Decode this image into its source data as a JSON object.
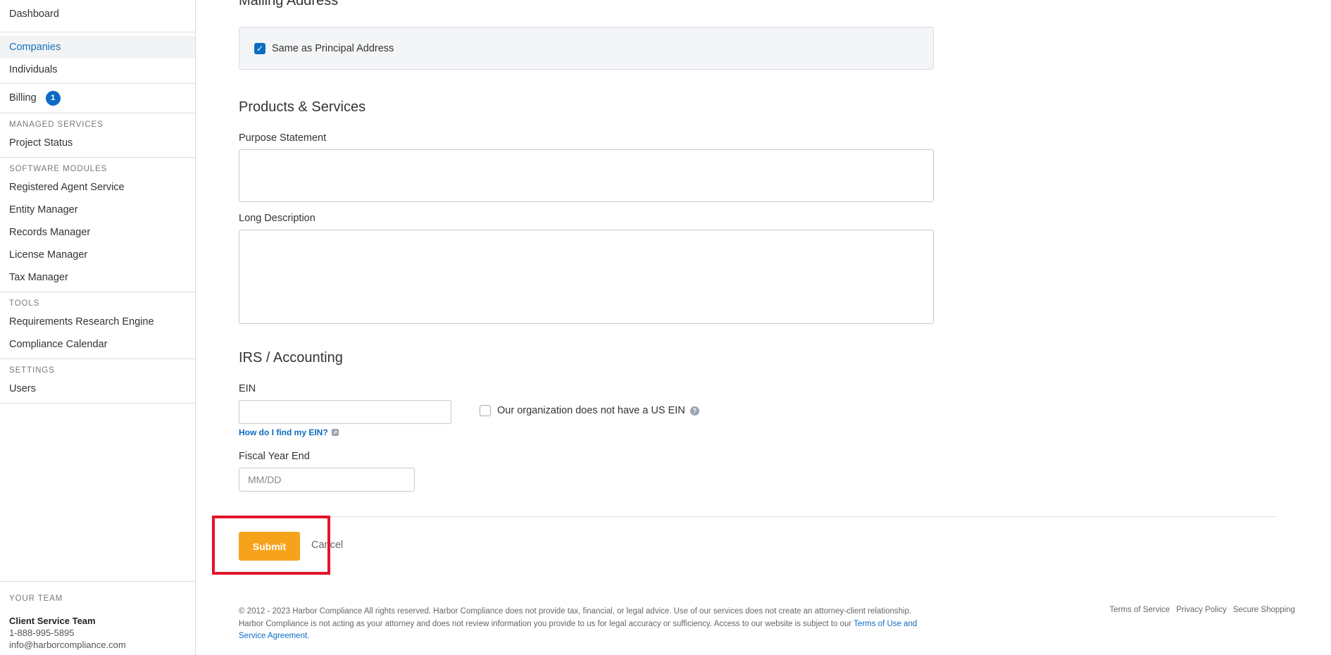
{
  "sidebar": {
    "dashboard": "Dashboard",
    "companies": "Companies",
    "individuals": "Individuals",
    "billing": "Billing",
    "billing_badge": "1",
    "managed_heading": "MANAGED SERVICES",
    "project_status": "Project Status",
    "software_heading": "SOFTWARE MODULES",
    "software_items": [
      "Registered Agent Service",
      "Entity Manager",
      "Records Manager",
      "License Manager",
      "Tax Manager"
    ],
    "tools_heading": "TOOLS",
    "tools_items": [
      "Requirements Research Engine",
      "Compliance Calendar"
    ],
    "settings_heading": "SETTINGS",
    "users": "Users",
    "team": {
      "heading": "YOUR TEAM",
      "name": "Client Service Team",
      "phone": "1-888-995-5895",
      "email": "info@harborcompliance.com"
    }
  },
  "form": {
    "mailing_title": "Mailing Address",
    "same_as_principal": "Same as Principal Address",
    "products_title": "Products & Services",
    "purpose_label": "Purpose Statement",
    "purpose_value": "",
    "long_desc_label": "Long Description",
    "long_desc_value": "",
    "irs_title": "IRS / Accounting",
    "ein_label": "EIN",
    "ein_value": "",
    "no_ein_label": "Our organization does not have a US EIN",
    "ein_help": "How do I find my EIN?",
    "fiscal_label": "Fiscal Year End",
    "fiscal_placeholder": "MM/DD",
    "submit": "Submit",
    "cancel": "Cancel"
  },
  "footer": {
    "text": "© 2012 - 2023 Harbor Compliance All rights reserved. Harbor Compliance does not provide tax, financial, or legal advice. Use of our services does not create an attorney-client relationship. Harbor Compliance is not acting as your attorney and does not review information you provide to us for legal accuracy or sufficiency. Access to our website is subject to our ",
    "terms_link": "Terms of Use and Service Agreement",
    "end": ".",
    "links": [
      "Terms of Service",
      "Privacy Policy",
      "Secure Shopping"
    ]
  }
}
